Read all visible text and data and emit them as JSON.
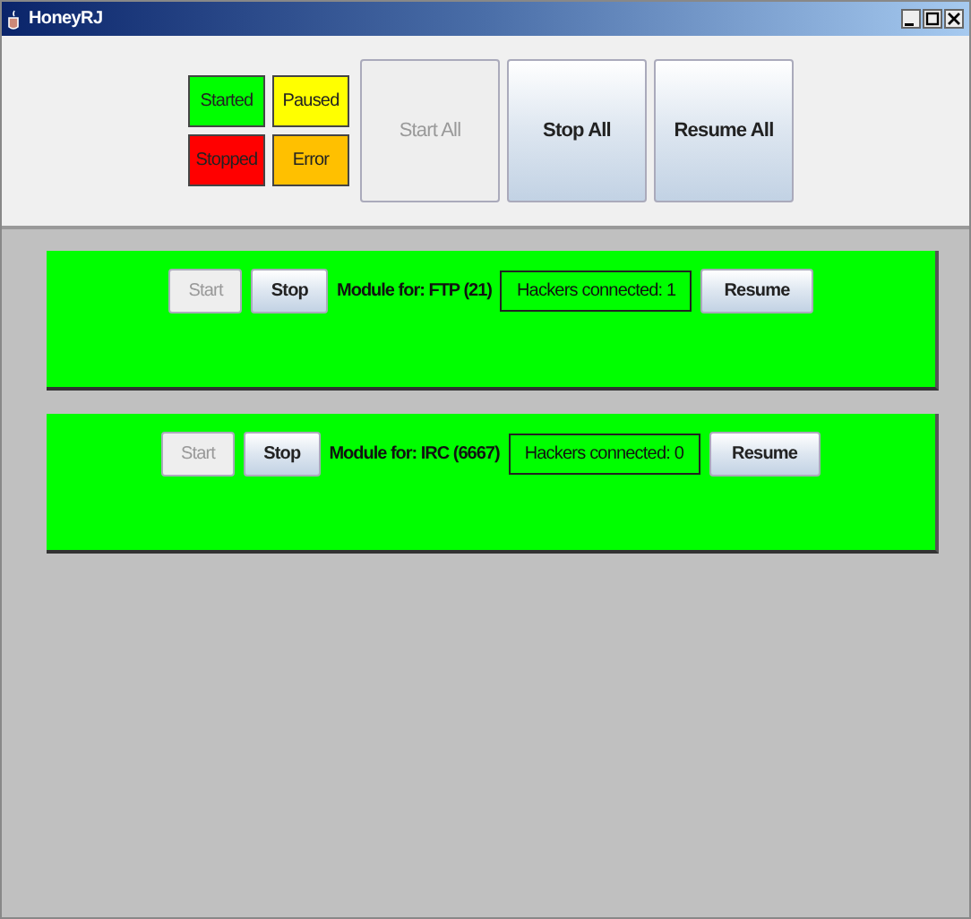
{
  "window": {
    "title": "HoneyRJ"
  },
  "legend": [
    {
      "label": "Started",
      "color": "#00ff00"
    },
    {
      "label": "Paused",
      "color": "#ffff00"
    },
    {
      "label": "Stopped",
      "color": "#ff0000"
    },
    {
      "label": "Error",
      "color": "#ffc000"
    }
  ],
  "toolbar": [
    {
      "label": "Start All",
      "disabled": true
    },
    {
      "label": "Stop All",
      "disabled": false
    },
    {
      "label": "Resume All",
      "disabled": false
    }
  ],
  "modules": [
    {
      "color": "#00ff00",
      "start": {
        "label": "Start",
        "disabled": true
      },
      "stop": {
        "label": "Stop",
        "disabled": false
      },
      "name": "Module for: FTP (21)",
      "hackers": "Hackers connected: 1",
      "resume": {
        "label": "Resume",
        "disabled": false
      }
    },
    {
      "color": "#00ff00",
      "start": {
        "label": "Start",
        "disabled": true
      },
      "stop": {
        "label": "Stop",
        "disabled": false
      },
      "name": "Module for: IRC (6667)",
      "hackers": "Hackers connected: 0",
      "resume": {
        "label": "Resume",
        "disabled": false
      }
    }
  ]
}
